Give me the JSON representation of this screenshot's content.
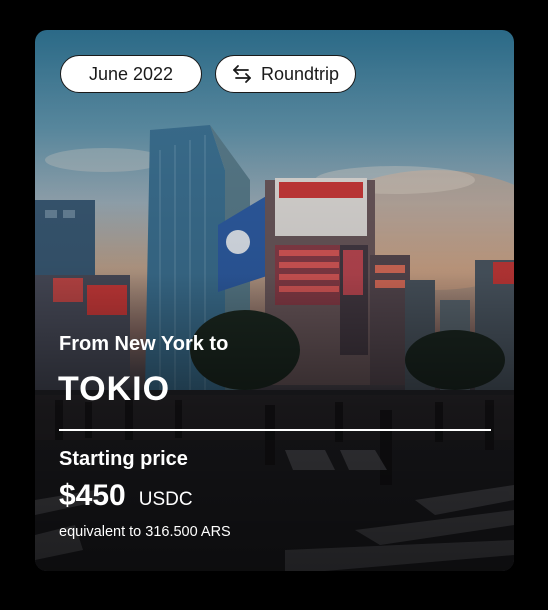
{
  "card": {
    "date_pill": "June 2022",
    "trip_pill": "Roundtrip",
    "trip_icon": "swap-arrows-icon",
    "from_text": "From New York to",
    "destination": "TOKIO",
    "price_label": "Starting price",
    "price": "$450",
    "currency": "USDC",
    "equivalent": "equivalent to 316.500 ARS"
  },
  "background": {
    "image": "city-street-photo"
  }
}
